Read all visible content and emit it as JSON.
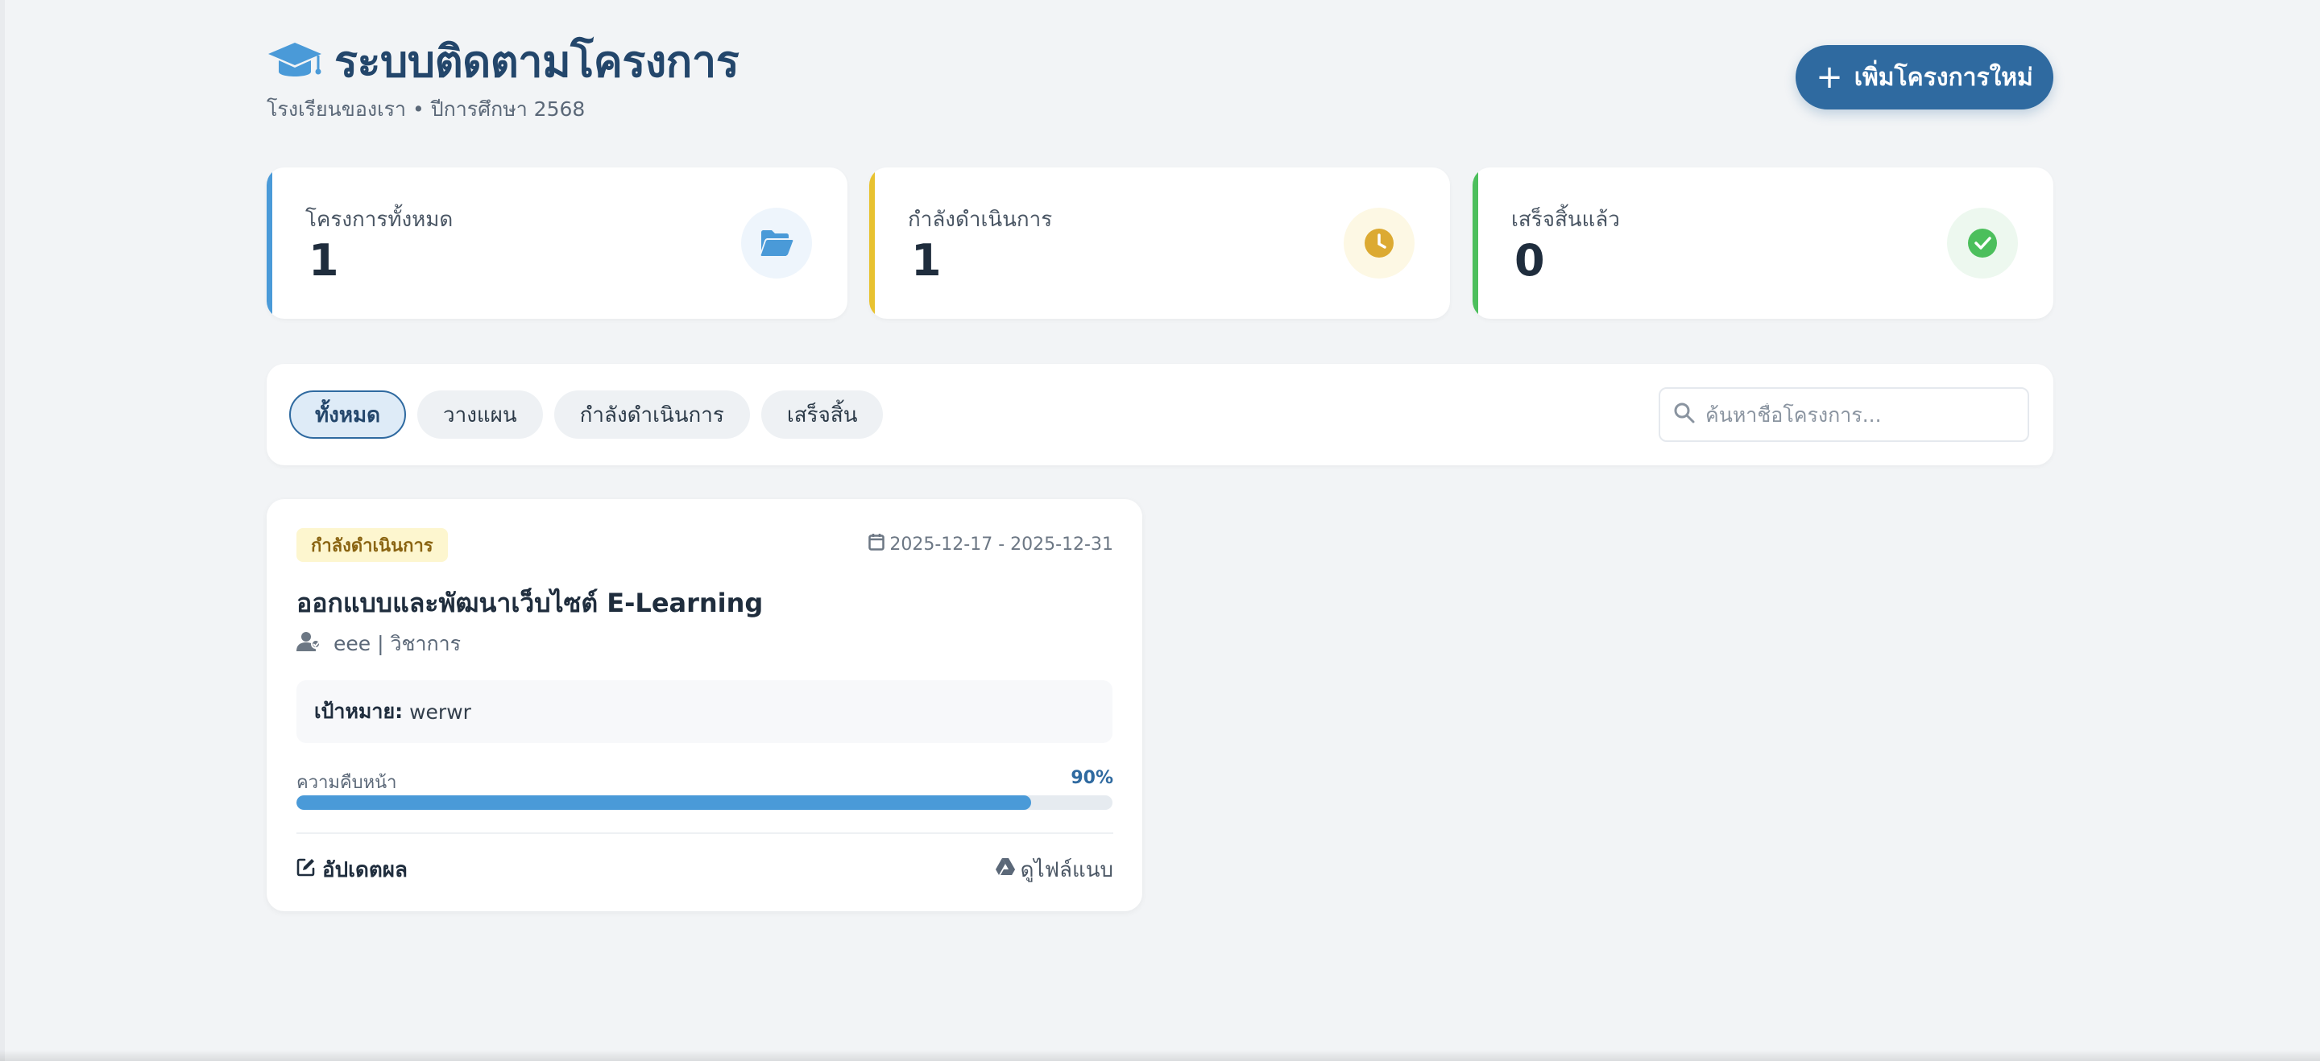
{
  "header": {
    "title": "ระบบติดตามโครงการ",
    "subtitle": "โรงเรียนของเรา • ปีการศึกษา 2568",
    "logo_icon": "graduation-cap-icon",
    "add_button_label": "เพิ่มโครงการใหม่"
  },
  "stats": [
    {
      "label": "โครงการทั้งหมด",
      "value": "1",
      "icon": "folder-open-icon",
      "accent": "#4a9ad8",
      "icon_bg": "#eef5fc"
    },
    {
      "label": "กำลังดำเนินการ",
      "value": "1",
      "icon": "clock-icon",
      "accent": "#e8c230",
      "icon_bg": "#fdf8e4"
    },
    {
      "label": "เสร็จสิ้นแล้ว",
      "value": "0",
      "icon": "check-circle-icon",
      "accent": "#4cbf5c",
      "icon_bg": "#edf8ef"
    }
  ],
  "filters": {
    "tabs": [
      {
        "label": "ทั้งหมด",
        "active": true
      },
      {
        "label": "วางแผน",
        "active": false
      },
      {
        "label": "กำลังดำเนินการ",
        "active": false
      },
      {
        "label": "เสร็จสิ้น",
        "active": false
      }
    ],
    "search_placeholder": "ค้นหาชื่อโครงการ...",
    "search_value": ""
  },
  "projects": [
    {
      "status": "กำลังดำเนินการ",
      "date_range": "2025-12-17 - 2025-12-31",
      "title": "ออกแบบและพัฒนาเว็บไซต์ E-Learning",
      "owner": "eee | วิชาการ",
      "goal_label": "เป้าหมาย:",
      "goal": "werwr",
      "progress_label": "ความคืบหน้า",
      "progress_text": "90%",
      "progress": 0.9,
      "update_label": "อัปเดตผล",
      "files_label": "ดูไฟล์แนบ"
    }
  ],
  "colors": {
    "primary": "#2f6aa0",
    "title": "#23466b",
    "progress": "#4a9ad8",
    "badge_bg": "#fdf6cf",
    "badge_text": "#8a6412"
  }
}
